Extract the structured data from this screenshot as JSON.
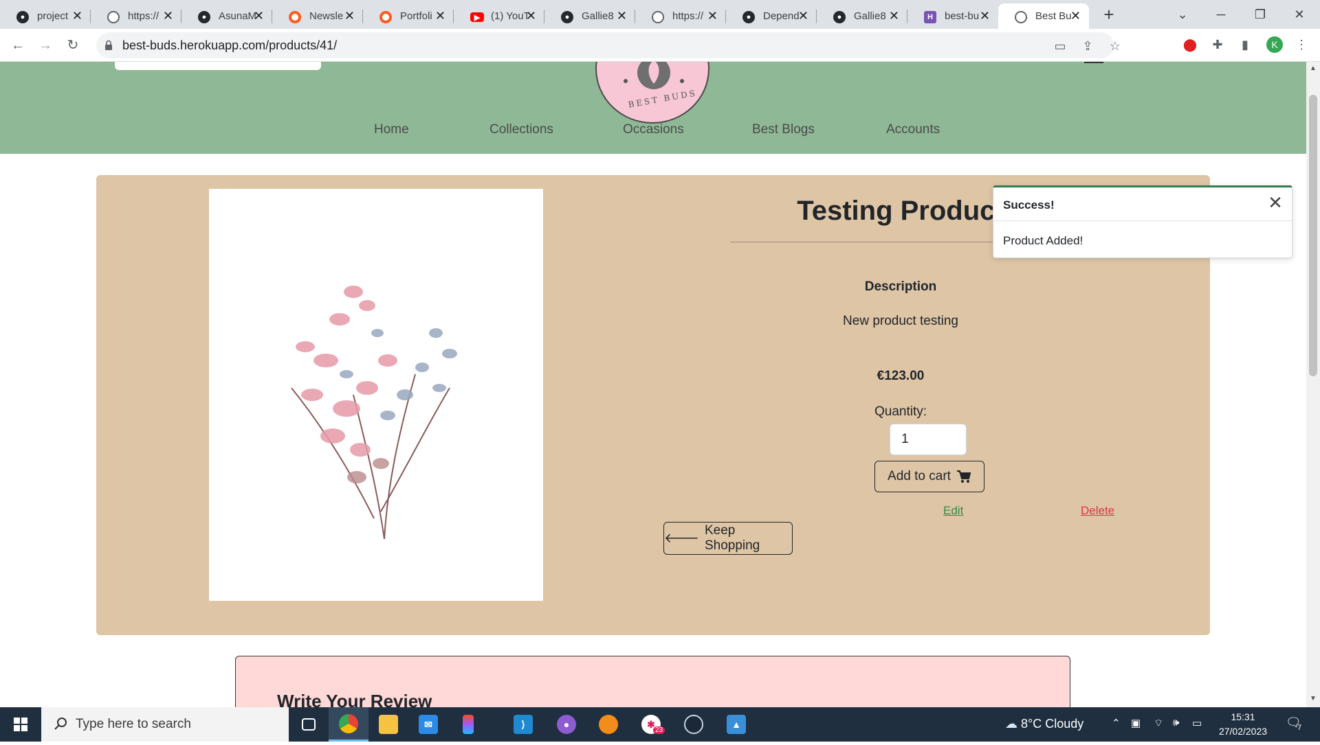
{
  "browser": {
    "tabs": [
      {
        "title": "project",
        "favicon": "github-icon"
      },
      {
        "title": "https://",
        "favicon": "globe-icon"
      },
      {
        "title": "AsunaM",
        "favicon": "github-icon"
      },
      {
        "title": "Newsle",
        "favicon": "opera-icon"
      },
      {
        "title": "Portfoli",
        "favicon": "opera-icon"
      },
      {
        "title": "(1) YouT",
        "favicon": "youtube-icon"
      },
      {
        "title": "Gallie8",
        "favicon": "github-icon"
      },
      {
        "title": "https://",
        "favicon": "globe-icon"
      },
      {
        "title": "Depend",
        "favicon": "github-icon"
      },
      {
        "title": "Gallie8",
        "favicon": "github-icon"
      },
      {
        "title": "best-bu",
        "favicon": "heroku-icon"
      },
      {
        "title": "Best Bu",
        "favicon": "globe-icon"
      }
    ],
    "url": "best-buds.herokuapp.com/products/41/",
    "profile_initial": "K"
  },
  "site": {
    "logo_text": "BEST BUDS",
    "nav": [
      "Home",
      "Collections",
      "Occasions",
      "Best Blogs",
      "Accounts"
    ]
  },
  "product": {
    "title": "Testing Product",
    "description_heading": "Description",
    "description": "New product testing",
    "price": "€123.00",
    "quantity_label": "Quantity:",
    "quantity_value": "1",
    "add_to_cart_label": "Add to cart",
    "edit_label": "Edit",
    "delete_label": "Delete",
    "keep_shopping_label": "Keep Shopping"
  },
  "review": {
    "heading": "Write Your Review"
  },
  "toast": {
    "title": "Success!",
    "message": "Product Added!"
  },
  "taskbar": {
    "search_placeholder": "Type here to search",
    "chat_badge": "23",
    "weather": "8°C  Cloudy",
    "time": "15:31",
    "date": "27/02/2023",
    "notifications": "7"
  },
  "colors": {
    "header_green": "#8fb996",
    "card_tan": "#dec5a6",
    "review_pink": "#ffd8d8",
    "toast_accent": "#2e7d4f",
    "edit_green": "#2e8b45",
    "delete_red": "#dc3545"
  }
}
